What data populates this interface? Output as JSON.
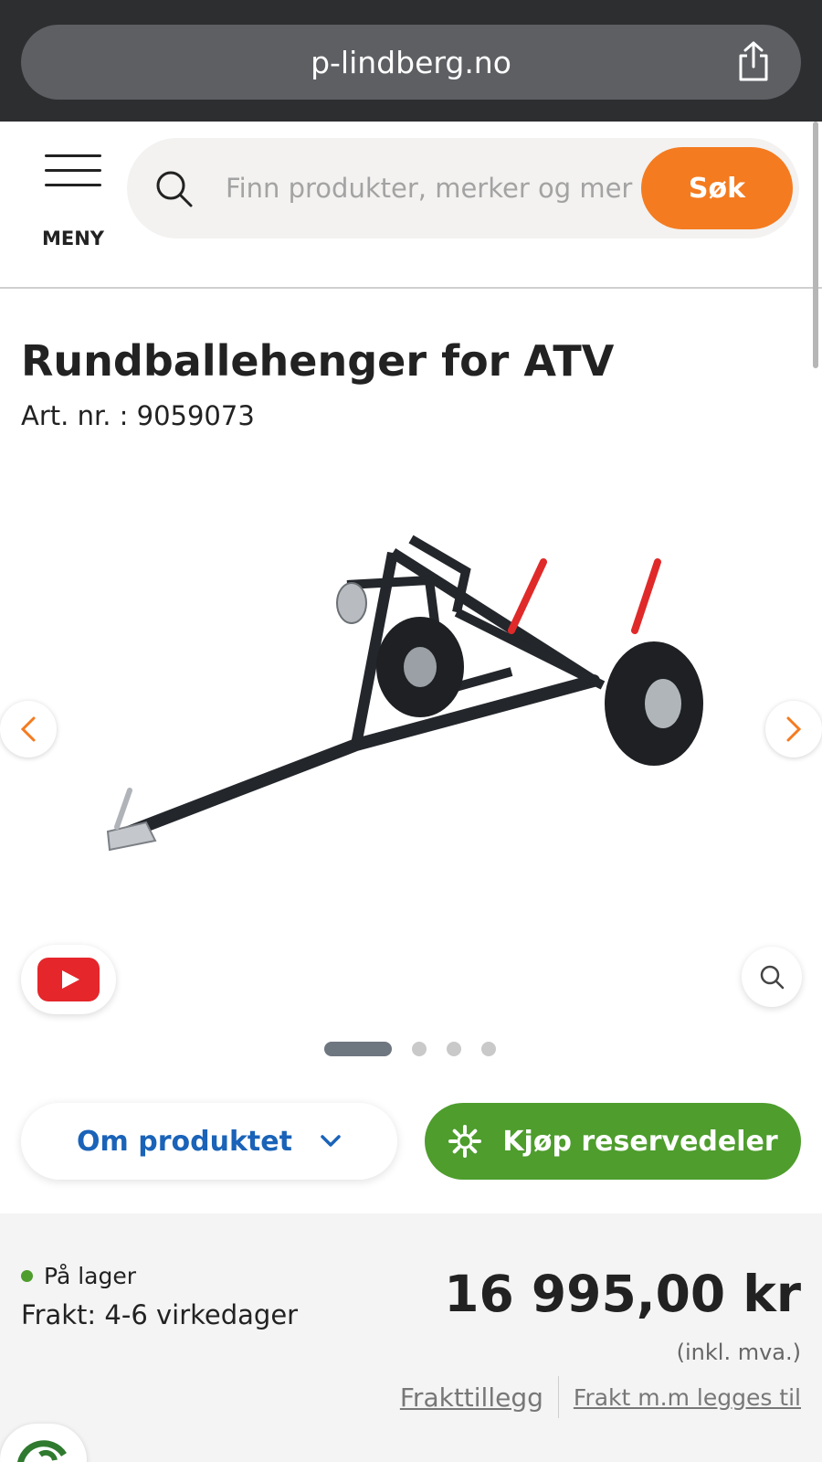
{
  "browser": {
    "url": "p-lindberg.no",
    "share_icon": "share-icon"
  },
  "header": {
    "menu_label": "MENY",
    "search_placeholder": "Finn produkter, merker og mer",
    "search_button": "Søk",
    "colors": {
      "accent": "#f47b20"
    }
  },
  "product": {
    "title": "Rundballehenger for ATV",
    "art_nr": "Art. nr. : 9059073",
    "image_count": 4,
    "active_image": 1
  },
  "actions": {
    "om_produktet": "Om produktet",
    "kjop_reservedeler": "Kjøp reservedeler",
    "colors": {
      "om": "#1a63b8",
      "kjop": "#4e9d2d"
    }
  },
  "purchase": {
    "stock_status": "På lager",
    "shipping": "Frakt: 4-6 virkedager",
    "price": "16 995,00 kr",
    "vat_note": "(inkl. mva.)",
    "link_frakttillegg": "Frakttillegg",
    "link_frakt_mm": "Frakt m.m legges til"
  }
}
